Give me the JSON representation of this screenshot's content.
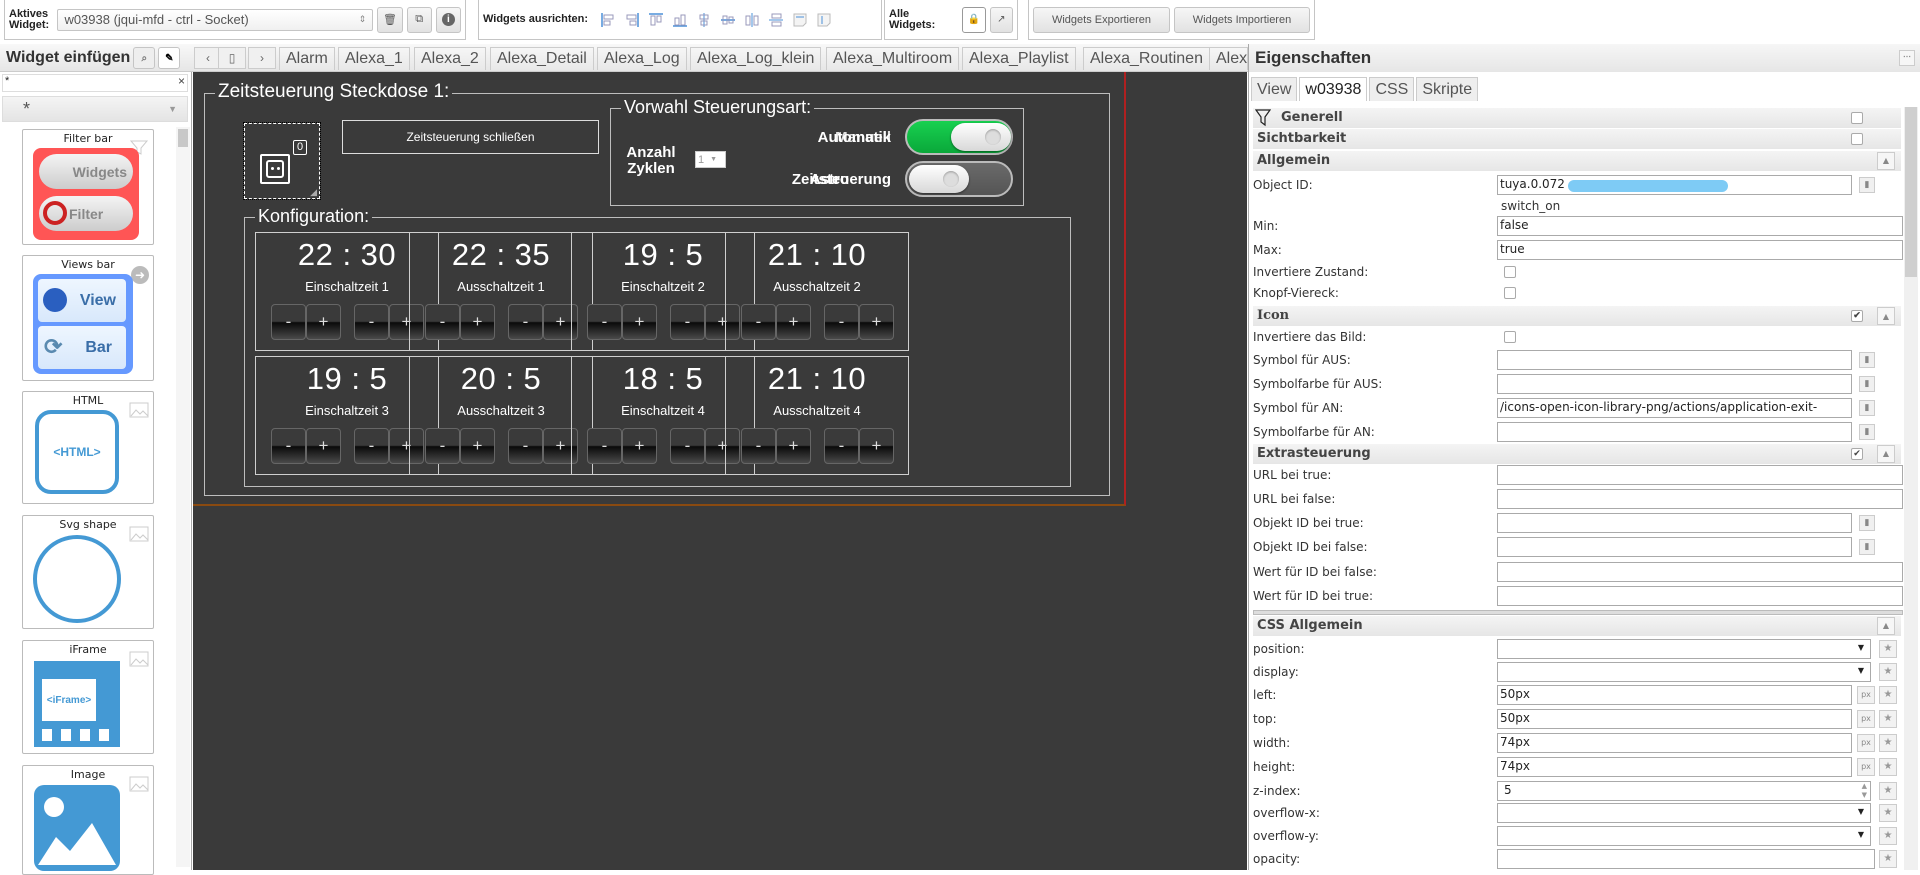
{
  "toolbar": {
    "active_widget_label": "Aktives Widget:",
    "active_widget_value": "w03938 (jqui-mfd - ctrl - Socket)",
    "align_label": "Widgets ausrichten:",
    "all_widgets_label": "Alle Widgets:",
    "export_label": "Widgets Exportieren",
    "import_label": "Widgets Importieren",
    "align_icons": [
      "align-left-icon",
      "align-right-icon",
      "align-top-icon",
      "align-bottom-icon",
      "align-vcenter-icon",
      "align-hcenter-icon",
      "distribute-h-icon",
      "distribute-v-icon",
      "same-width-icon",
      "same-height-icon"
    ]
  },
  "palette": {
    "title": "Widget einfügen",
    "search_value": "*",
    "filter_value": "*",
    "widgets": [
      {
        "title": "Filter bar",
        "kind": "filter-bar"
      },
      {
        "title": "Views bar",
        "kind": "views-bar"
      },
      {
        "title": "HTML",
        "kind": "html"
      },
      {
        "title": "Svg shape",
        "kind": "svg-shape"
      },
      {
        "title": "iFrame",
        "kind": "iframe"
      },
      {
        "title": "Image",
        "kind": "image"
      }
    ],
    "filter_bar_texts": [
      "Widgets",
      "Filter"
    ],
    "views_bar_texts": [
      "View",
      "Bar"
    ],
    "html_text": "<HTML>",
    "iframe_text": "<iFrame>"
  },
  "view_tabs": [
    "Alarm",
    "Alexa_1",
    "Alexa_2",
    "Alexa_Detail",
    "Alexa_Log",
    "Alexa_Log_klein",
    "Alexa_Multiroom",
    "Alexa_Playlist",
    "Alexa_Routinen",
    "Alex"
  ],
  "canvas": {
    "main_title": "Zeitsteuerung Steckdose 1:",
    "socket_badge": "0",
    "close_button": "Zeitsteuerung schließen",
    "mode_title": "Vorwahl Steuerungsart:",
    "cycles_label": "Anzahl Zyklen",
    "cycles_value": "1",
    "toggle1_labels": [
      "Automatik",
      "Manuell"
    ],
    "toggle1_on": true,
    "toggle2_labels": [
      "Astro",
      "Zeitsteuerung"
    ],
    "toggle2_on": false,
    "config_title": "Konfiguration:",
    "minus": "-",
    "plus": "+",
    "times": [
      {
        "value": "22 : 30",
        "label": "Einschaltzeit 1"
      },
      {
        "value": "22 : 35",
        "label": "Ausschaltzeit 1"
      },
      {
        "value": "19 : 5",
        "label": "Einschaltzeit 2"
      },
      {
        "value": "21 : 10",
        "label": "Ausschaltzeit 2"
      },
      {
        "value": "19 : 5",
        "label": "Einschaltzeit 3"
      },
      {
        "value": "20 : 5",
        "label": "Ausschaltzeit 3"
      },
      {
        "value": "18 : 5",
        "label": "Einschaltzeit 4"
      },
      {
        "value": "21 : 10",
        "label": "Ausschaltzeit 4"
      }
    ]
  },
  "props": {
    "title": "Eigenschaften",
    "tabs": [
      "View",
      "w03938",
      "CSS",
      "Skripte"
    ],
    "active_tab": "w03938",
    "groups": {
      "generell": "Generell",
      "sichtbarkeit": "Sichtbarkeit",
      "allgemein": "Allgemein",
      "icon": "Icon",
      "extra": "Extrasteuerung",
      "css": "CSS Allgemein"
    },
    "allgemein": {
      "object_id_label": "Object ID:",
      "object_id_value": "tuya.0.072",
      "object_id_hint": "switch_on",
      "min_label": "Min:",
      "min_value": "false",
      "max_label": "Max:",
      "max_value": "true",
      "invert_label": "Invertiere Zustand:",
      "square_label": "Knopf-Viereck:"
    },
    "icon": {
      "invert_img_label": "Invertiere das Bild:",
      "sym_off_label": "Symbol für AUS:",
      "sym_off_value": "",
      "symcol_off_label": "Symbolfarbe für AUS:",
      "symcol_off_value": "",
      "sym_on_label": "Symbol für AN:",
      "sym_on_value": "/icons-open-icon-library-png/actions/application-exit-",
      "symcol_on_label": "Symbolfarbe für AN:",
      "symcol_on_value": ""
    },
    "extra": {
      "url_true_label": "URL bei true:",
      "url_false_label": "URL bei false:",
      "oid_true_label": "Objekt ID bei true:",
      "oid_false_label": "Objekt ID bei false:",
      "val_false_label": "Wert für ID bei false:",
      "val_true_label": "Wert für ID bei true:"
    },
    "css": {
      "position_label": "position:",
      "position_value": "",
      "display_label": "display:",
      "display_value": "",
      "left_label": "left:",
      "left_value": "50px",
      "top_label": "top:",
      "top_value": "50px",
      "width_label": "width:",
      "width_value": "74px",
      "height_label": "height:",
      "height_value": "74px",
      "zindex_label": "z-index:",
      "zindex_value": "5",
      "ovx_label": "overflow-x:",
      "ovx_value": "",
      "ovy_label": "overflow-y:",
      "ovy_value": "",
      "opacity_label": "opacity:",
      "unit": "px"
    }
  }
}
